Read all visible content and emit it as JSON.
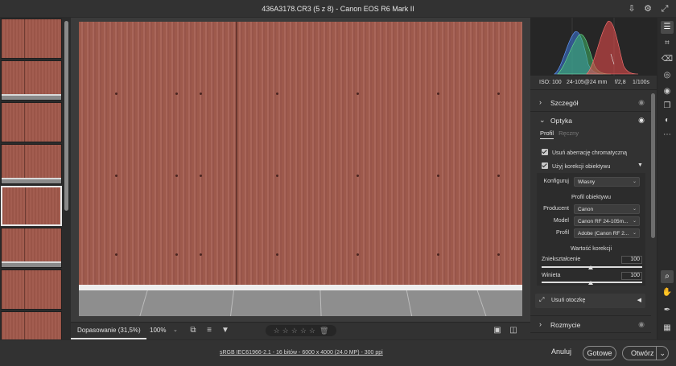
{
  "titlebar": {
    "title": "436A3178.CR3 (5 z 8)  -  Canon EOS R6 Mark II",
    "icons": [
      "export-icon",
      "gear-icon",
      "expand-icon"
    ]
  },
  "filmstrip": {
    "count": 8,
    "selected_index": 4
  },
  "bottombar": {
    "fit_label": "Dopasowanie (31,5%)",
    "zoom_label": "100%",
    "rating_stars": "☆☆☆☆☆",
    "icons": [
      "compare-icon",
      "sort-icon",
      "filter-icon",
      "trash-icon",
      "before-after-icon",
      "split-view-icon"
    ]
  },
  "exif": {
    "iso": "ISO: 100",
    "lens": "24-105@24 mm",
    "aperture": "f/2,8",
    "shutter": "1/100s"
  },
  "panel": {
    "szczegol": "Szczegół",
    "optyka": "Optyka",
    "tab_profil": "Profil",
    "tab_reczny": "Ręczny",
    "check_aberration": "Usuń aberrację chromatyczną",
    "check_lens": "Użyj korekcji obiektywu",
    "konfiguruj_label": "Konfiguruj",
    "konfiguruj_value": "Własny",
    "profile_title": "Profil obiektywu",
    "producent_label": "Producent",
    "producent_value": "Canon",
    "model_label": "Model",
    "model_value": "Canon RF 24-105m...",
    "profil_label": "Profil",
    "profil_value": "Adobe (Canon RF 2...",
    "correction_title": "Wartość korekcji",
    "distortion_label": "Zniekształcenie",
    "distortion_value": "100",
    "vignette_label": "Winieta",
    "vignette_value": "100",
    "remove_fringe": "Usuń otoczkę",
    "rozmycie": "Rozmycie"
  },
  "statusbar": {
    "info": "sRGB IEC61966-2.1 - 16 bitów - 6000 x 4000 (24.0 MP) - 300 ppi",
    "cancel": "Anuluj",
    "done": "Gotowe",
    "open": "Otwórz"
  },
  "toolrail": {
    "icons": [
      "edit-icon",
      "crop-icon",
      "eraser-icon",
      "mask-icon",
      "redeye-icon",
      "presets-icon",
      "snapshot-icon",
      "more-icon",
      "zoom-icon",
      "hand-icon",
      "sampler-icon",
      "grid-icon"
    ]
  },
  "colors": {
    "histogram_red": "#e04a4a",
    "histogram_green": "#3fc06a",
    "histogram_blue": "#3a78e0",
    "wall": "#a35d50"
  }
}
